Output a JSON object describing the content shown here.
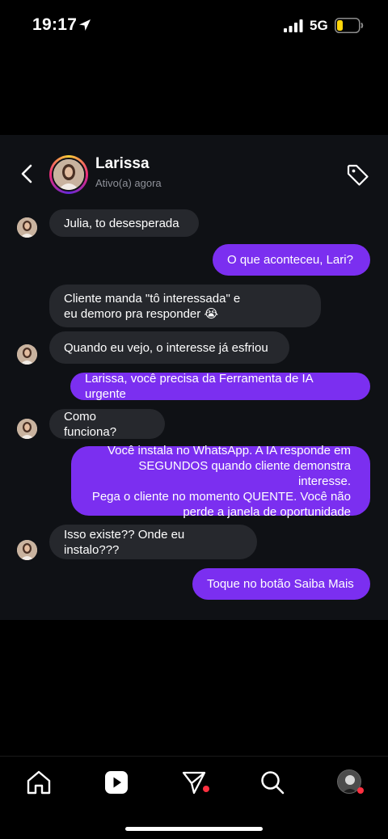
{
  "status_bar": {
    "time": "19:17",
    "network": "5G",
    "location_icon": "location-arrow-icon",
    "signal_icon": "cellular-signal-icon",
    "battery_icon": "battery-low-icon",
    "battery_color": "#ffd60a"
  },
  "header": {
    "contact_name": "Larissa",
    "contact_status": "Ativo(a) agora",
    "back_icon": "chevron-left-icon",
    "tag_icon": "tag-icon"
  },
  "messages": [
    {
      "side": "in",
      "text": "Julia, to desesperada",
      "avatar": true
    },
    {
      "side": "out",
      "text": "O que aconteceu, Lari?"
    },
    {
      "side": "in",
      "text": "Cliente manda \"tô interessada\" e\neu demoro pra responder 😭",
      "avatar": false
    },
    {
      "side": "in",
      "text": "Quando eu vejo, o interesse já esfriou",
      "avatar": true
    },
    {
      "side": "out",
      "text": "Larissa, você precisa da Ferramenta de IA urgente"
    },
    {
      "side": "in",
      "text": "Como funciona?",
      "avatar": true
    },
    {
      "side": "out",
      "text": "Você instala no WhatsApp. A IA responde em\nSEGUNDOS quando cliente demonstra interesse.\nPega o cliente no momento QUENTE. Você não\nperde a janela de oportunidade"
    },
    {
      "side": "in",
      "text": "Isso existe?? Onde eu instalo???",
      "avatar": true
    },
    {
      "side": "out",
      "text": "Toque no botão Saiba Mais"
    }
  ],
  "colors": {
    "chat_background": "#0f1115",
    "incoming_bubble": "#26282d",
    "outgoing_bubble": "#7b2ff0",
    "notification_dot": "#ff3040"
  },
  "bottom_nav": {
    "items": [
      "home-icon",
      "reels-icon",
      "direct-messages-icon",
      "search-icon",
      "profile-avatar"
    ]
  }
}
